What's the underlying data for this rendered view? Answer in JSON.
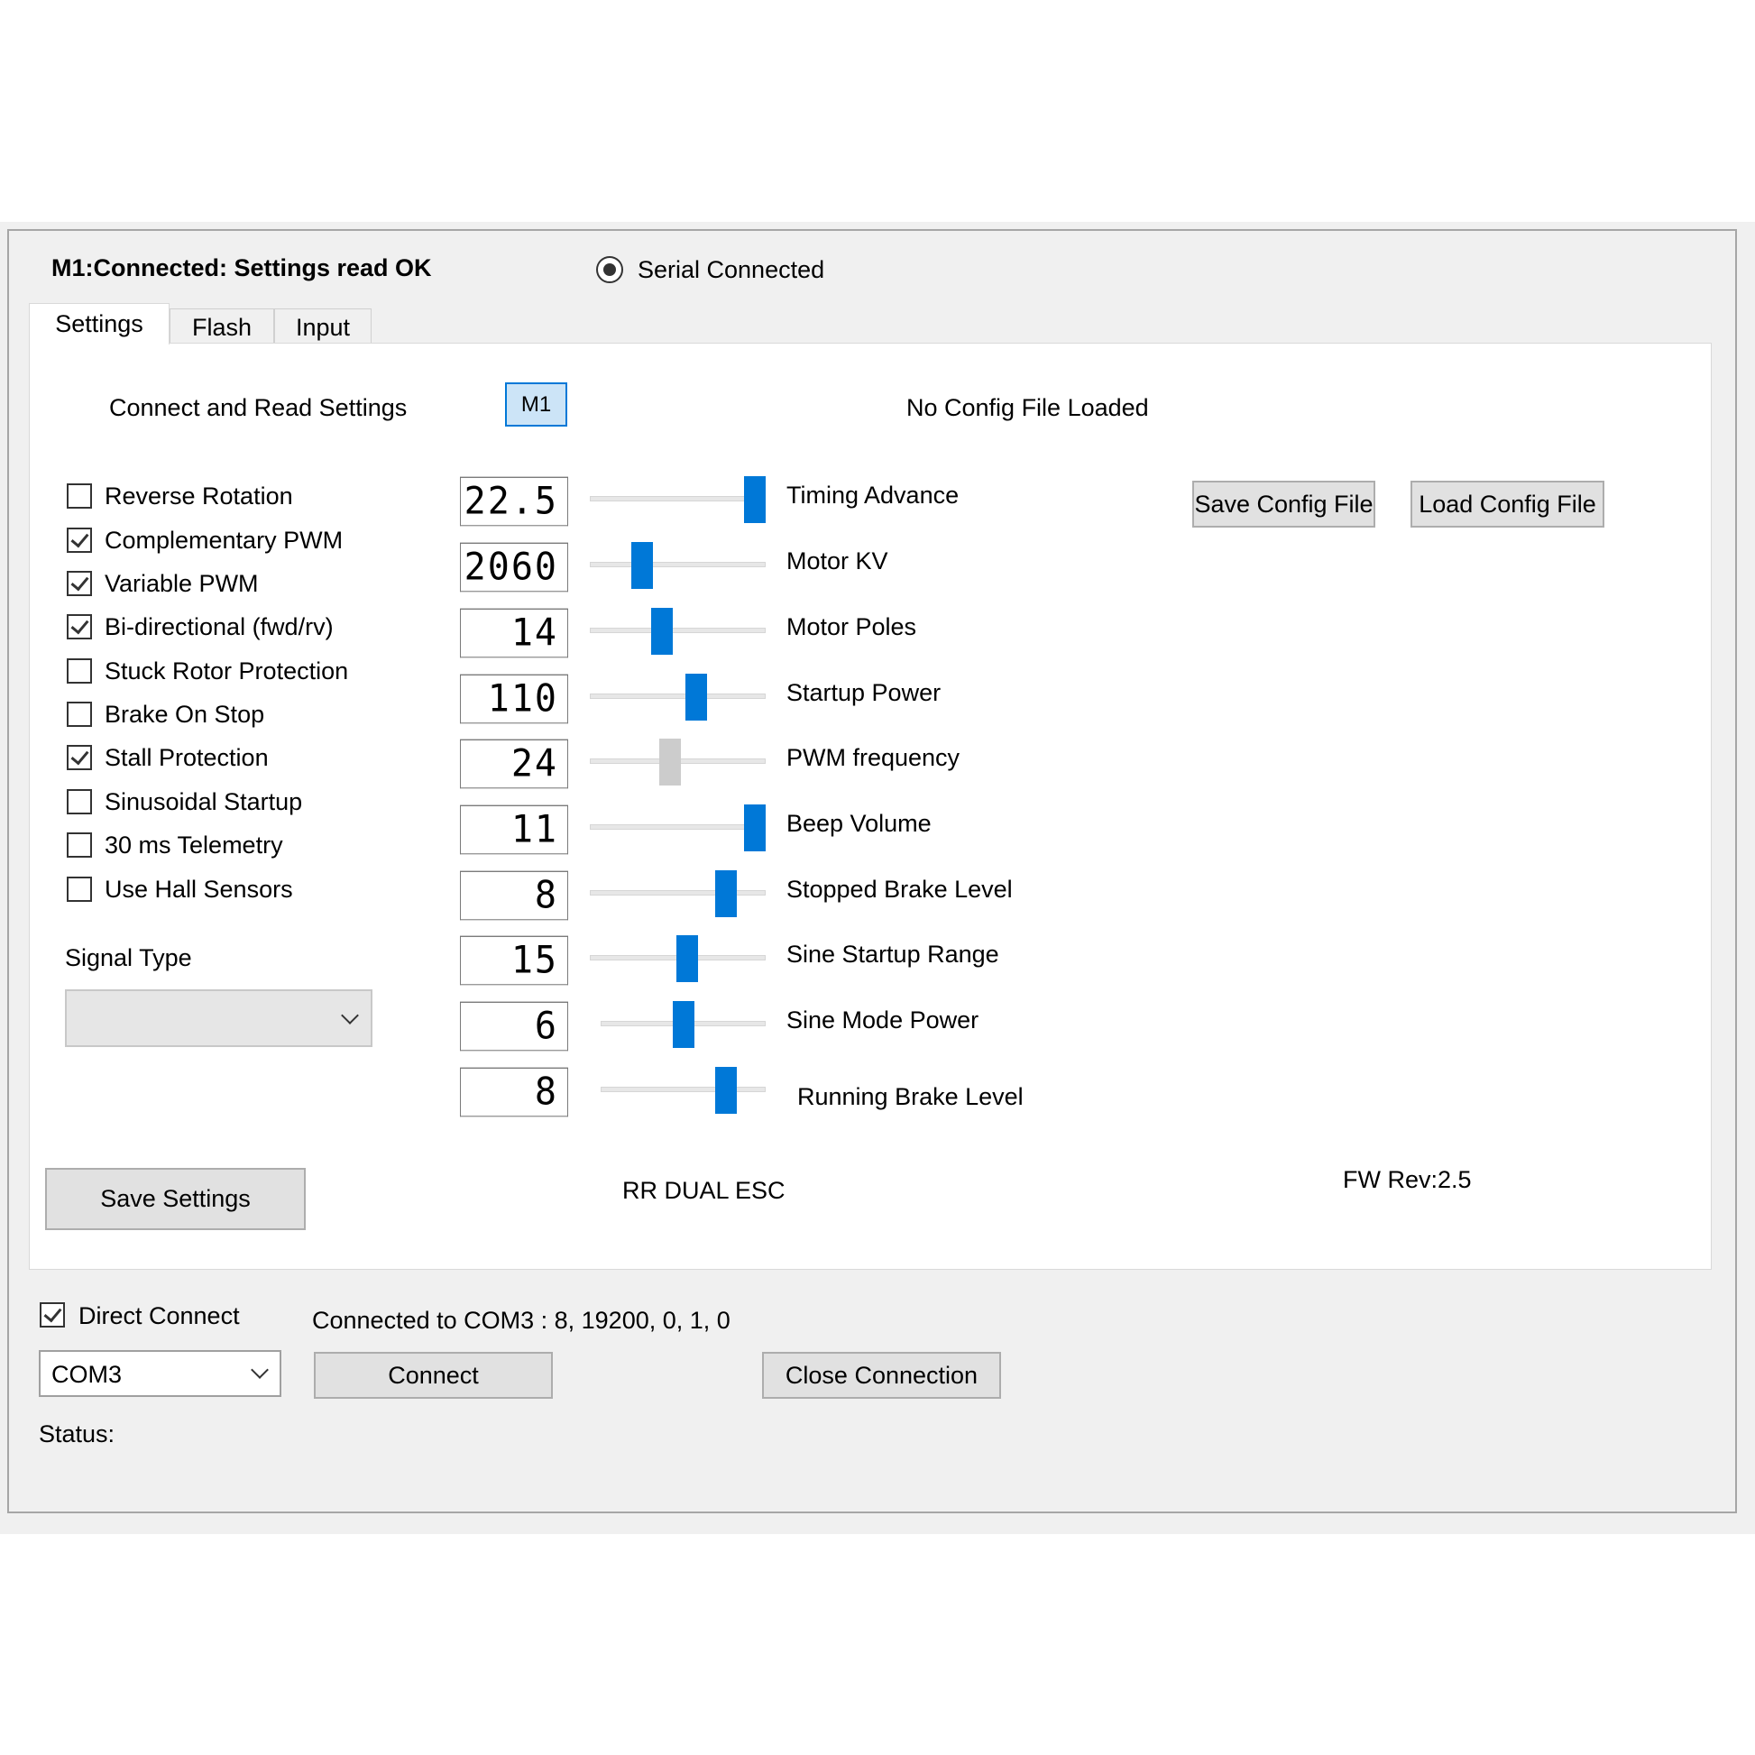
{
  "header": {
    "status_title": "M1:Connected: Settings read OK",
    "serial_label": "Serial Connected"
  },
  "tabs": [
    {
      "label": "Settings",
      "active": true
    },
    {
      "label": "Flash",
      "active": false
    },
    {
      "label": "Input",
      "active": false
    }
  ],
  "settings": {
    "connect_read_label": "Connect and Read Settings",
    "m1_button": "M1",
    "config_status": "No Config File Loaded",
    "save_config_button": "Save Config File",
    "load_config_button": "Load Config File",
    "checkboxes": [
      {
        "label": "Reverse Rotation",
        "checked": false
      },
      {
        "label": "Complementary PWM",
        "checked": true
      },
      {
        "label": "Variable PWM",
        "checked": true
      },
      {
        "label": "Bi-directional (fwd/rv)",
        "checked": true
      },
      {
        "label": "Stuck Rotor Protection",
        "checked": false
      },
      {
        "label": "Brake On Stop",
        "checked": false
      },
      {
        "label": "Stall Protection",
        "checked": true
      },
      {
        "label": "Sinusoidal Startup",
        "checked": false
      },
      {
        "label": "30 ms Telemetry",
        "checked": false
      },
      {
        "label": "Use Hall Sensors",
        "checked": false
      }
    ],
    "signal_type_label": "Signal Type",
    "signal_type_value": "",
    "sliders": [
      {
        "display": "22.5",
        "label": "Timing Advance",
        "level": 1.0,
        "enabled": true
      },
      {
        "display": "2060",
        "label": "Motor KV",
        "level": 0.27,
        "enabled": true
      },
      {
        "display": "14",
        "label": "Motor Poles",
        "level": 0.4,
        "enabled": true
      },
      {
        "display": "110",
        "label": "Startup Power",
        "level": 0.62,
        "enabled": true
      },
      {
        "display": "24",
        "label": "PWM frequency",
        "level": 0.45,
        "enabled": false
      },
      {
        "display": "11",
        "label": "Beep Volume",
        "level": 1.0,
        "enabled": true
      },
      {
        "display": "8",
        "label": "Stopped Brake Level",
        "level": 0.81,
        "enabled": true
      },
      {
        "display": "15",
        "label": "Sine Startup Range",
        "level": 0.56,
        "enabled": true
      },
      {
        "display": "6",
        "label": "Sine Mode Power",
        "level": 0.5,
        "enabled": true
      },
      {
        "display": "8",
        "label": "Running Brake Level",
        "level": 0.8,
        "enabled": true
      }
    ],
    "save_settings_button": "Save Settings",
    "device_name": "RR DUAL ESC",
    "fw_rev": "FW Rev:2.5"
  },
  "connection": {
    "direct_connect_label": "Direct Connect",
    "direct_connect_checked": true,
    "connected_text": "Connected to COM3 : 8, 19200, 0, 1, 0",
    "port_value": "COM3",
    "connect_button": "Connect",
    "close_button": "Close Connection",
    "status_label": "Status:"
  },
  "colors": {
    "accent": "#0078d7",
    "window_bg": "#f0f0f0",
    "panel_bg": "#ffffff"
  }
}
